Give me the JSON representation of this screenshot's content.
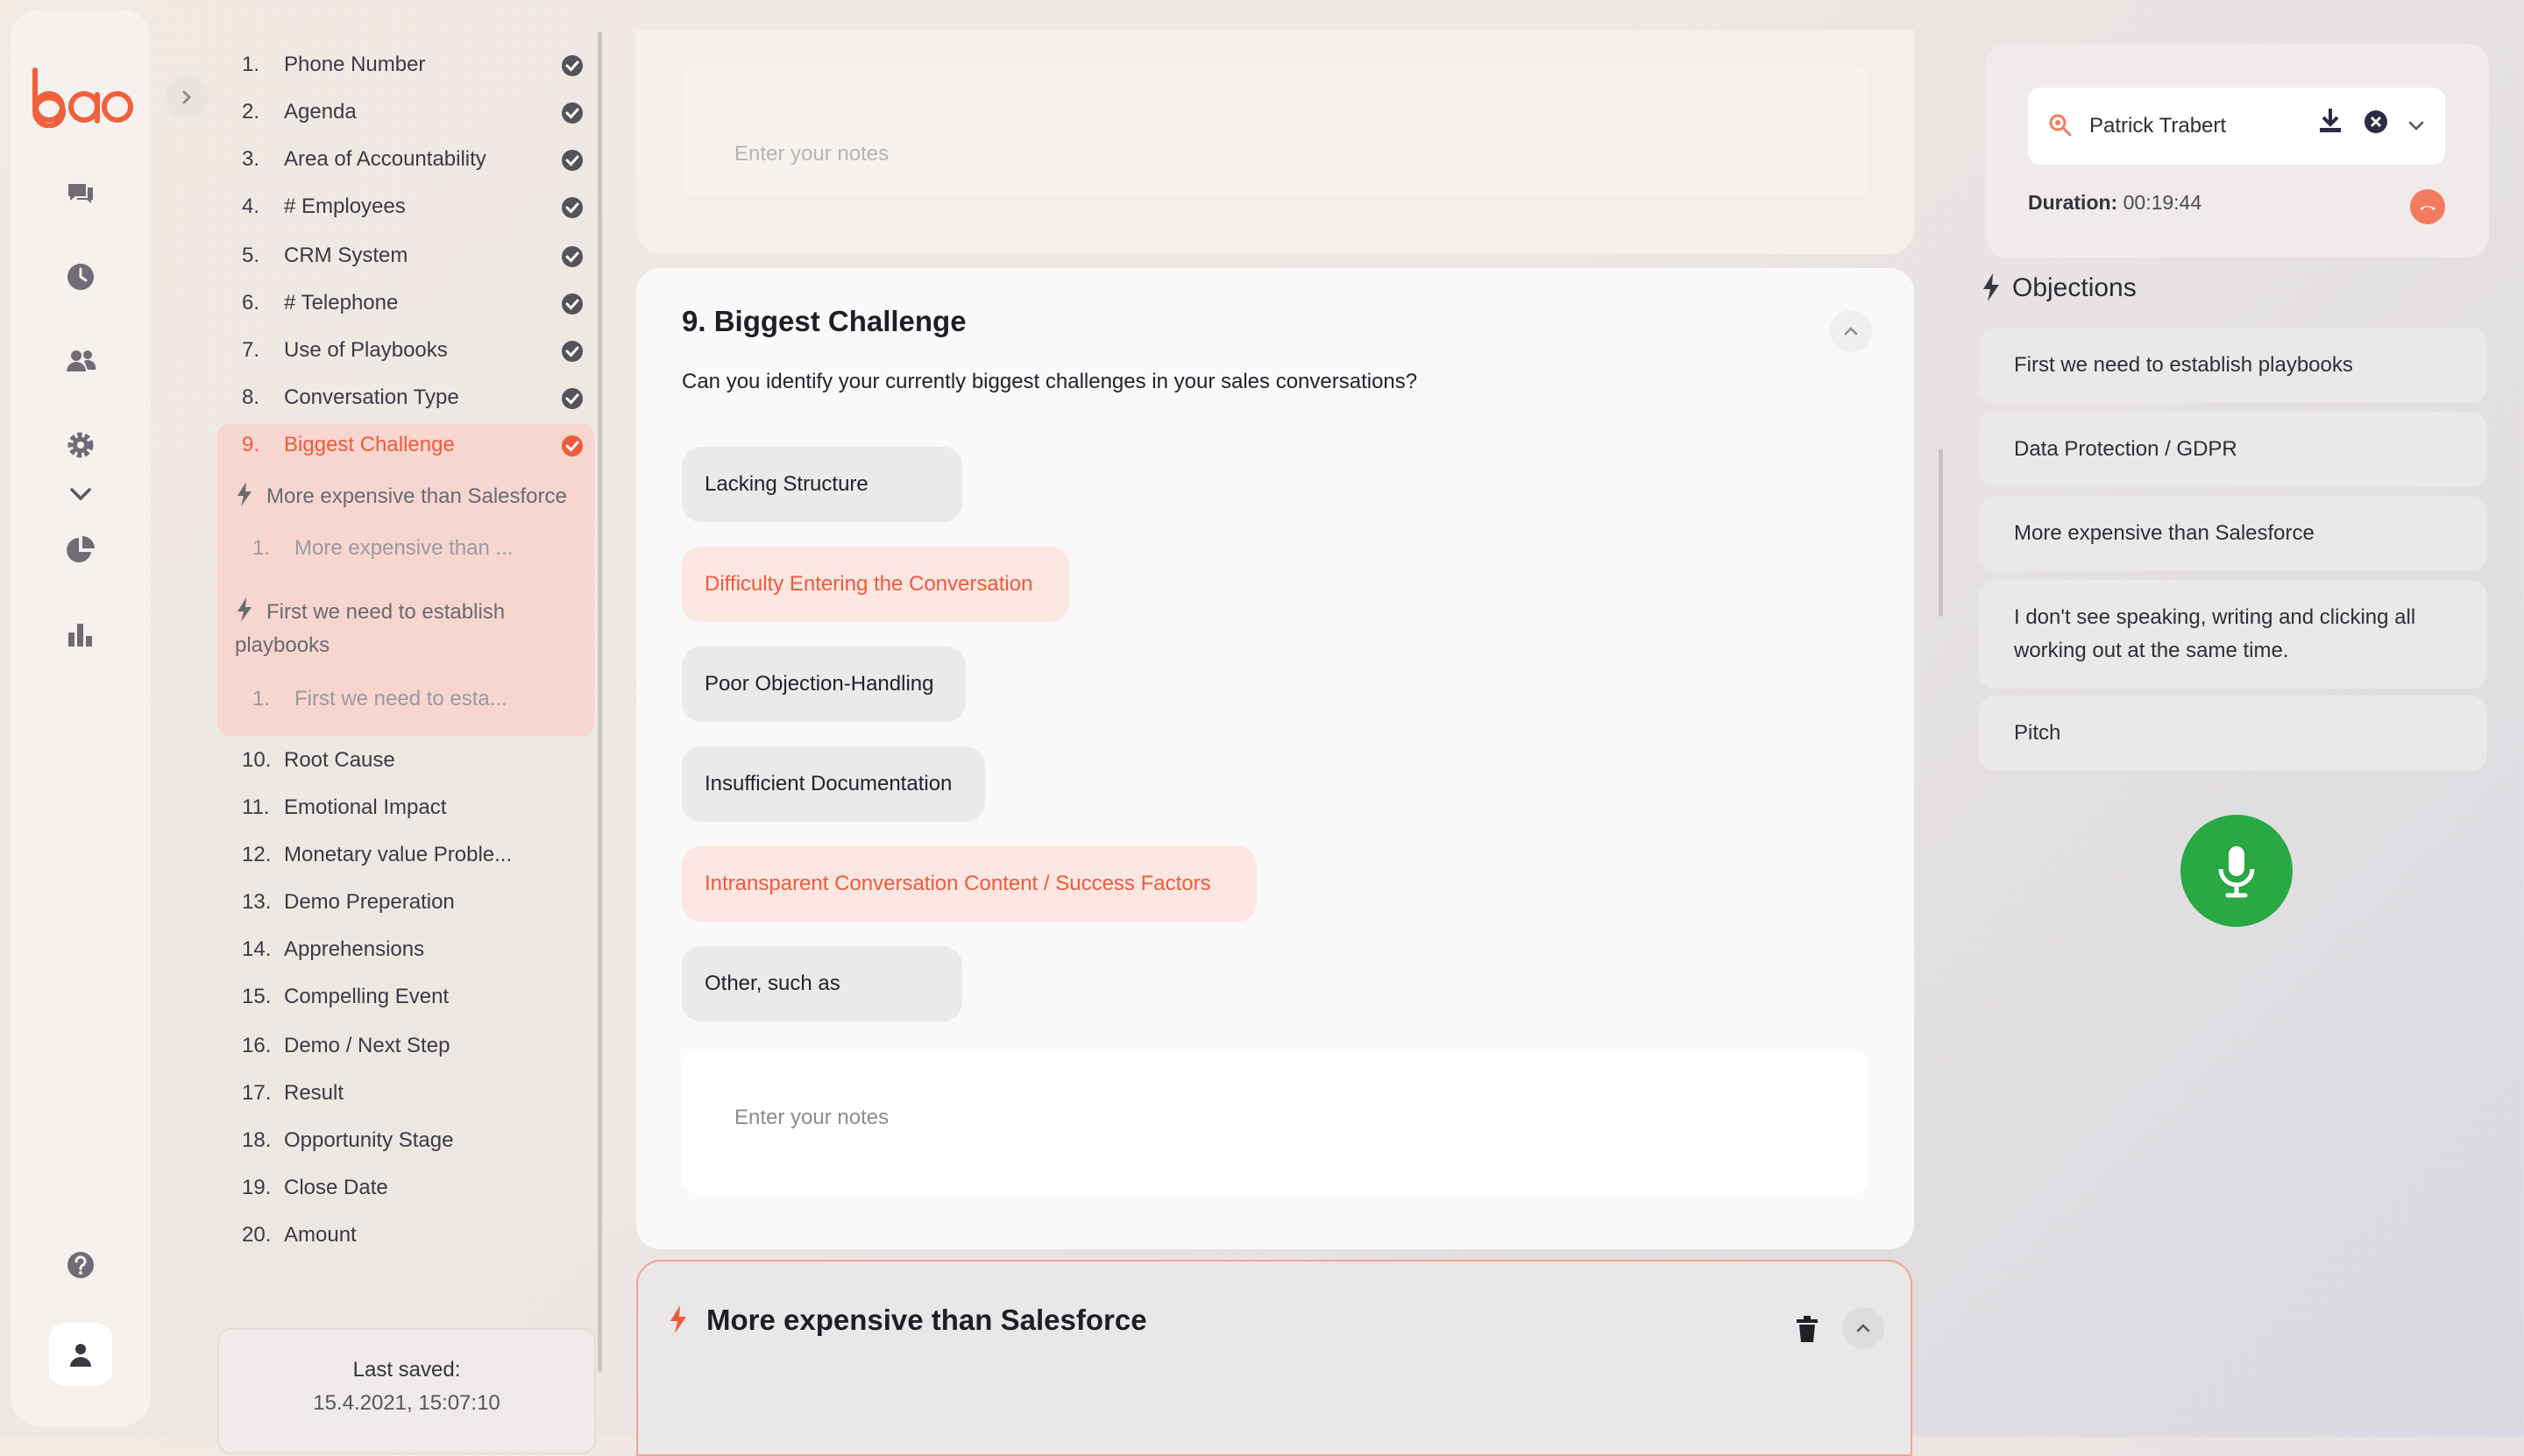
{
  "brand": {
    "logo_text": "bao",
    "accent": "#f05a3a"
  },
  "rail": {
    "icons": [
      "chat-icon",
      "clock-icon",
      "users-icon",
      "gear-icon",
      "chevron-down-icon",
      "pie-chart-icon",
      "bar-chart-icon",
      "help-icon",
      "user-avatar-icon"
    ]
  },
  "agenda": {
    "items": [
      {
        "num": "1.",
        "label": "Phone Number",
        "done": true
      },
      {
        "num": "2.",
        "label": "Agenda",
        "done": true
      },
      {
        "num": "3.",
        "label": "Area of Accountability",
        "done": true
      },
      {
        "num": "4.",
        "label": "# Employees",
        "done": true
      },
      {
        "num": "5.",
        "label": "CRM System",
        "done": true
      },
      {
        "num": "6.",
        "label": "# Telephone",
        "done": true
      },
      {
        "num": "7.",
        "label": "Use of Playbooks",
        "done": true
      },
      {
        "num": "8.",
        "label": "Conversation Type",
        "done": true
      },
      {
        "num": "9.",
        "label": "Biggest Challenge",
        "done": true,
        "active": true
      },
      {
        "num": "10.",
        "label": "Root Cause"
      },
      {
        "num": "11.",
        "label": "Emotional Impact"
      },
      {
        "num": "12.",
        "label": "Monetary value Proble..."
      },
      {
        "num": "13.",
        "label": "Demo Preperation"
      },
      {
        "num": "14.",
        "label": "Apprehensions"
      },
      {
        "num": "15.",
        "label": "Compelling Event"
      },
      {
        "num": "16.",
        "label": "Demo / Next Step"
      },
      {
        "num": "17.",
        "label": "Result"
      },
      {
        "num": "18.",
        "label": "Opportunity Stage"
      },
      {
        "num": "19.",
        "label": "Close Date"
      },
      {
        "num": "20.",
        "label": "Amount"
      }
    ],
    "active_sub": [
      {
        "objection": "More expensive than Salesforce",
        "sub_num": "1.",
        "sub_label": "More expensive than ..."
      },
      {
        "objection": "First we need to establish playbooks",
        "sub_num": "1.",
        "sub_label": "First we need to esta..."
      }
    ],
    "last_saved_label": "Last saved:",
    "last_saved_value": "15.4.2021, 15:07:10"
  },
  "main": {
    "prev_notes_placeholder": "Enter your notes",
    "section_title": "9. Biggest Challenge",
    "question": "Can you identify your currently biggest challenges in your sales conversations?",
    "options": [
      {
        "label": "Lacking Structure",
        "selected": false
      },
      {
        "label": "Difficulty Entering the Conversation",
        "selected": true
      },
      {
        "label": "Poor Objection-Handling",
        "selected": false
      },
      {
        "label": "Insufficient Documentation",
        "selected": false
      },
      {
        "label": "Intransparent Conversation Content / Success Factors",
        "selected": true
      },
      {
        "label": "Other, such as",
        "selected": false
      }
    ],
    "notes_placeholder": "Enter your notes",
    "objection_card_title": "More expensive than Salesforce"
  },
  "call": {
    "contact": "Patrick Trabert",
    "duration_label": "Duration:",
    "duration_value": "00:19:44"
  },
  "objections": {
    "header": "Objections",
    "items": [
      "First we need to establish playbooks",
      "Data Protection / GDPR",
      "More expensive than Salesforce",
      "I don't see speaking, writing and clicking all working out at the same time.",
      "Pitch"
    ]
  }
}
